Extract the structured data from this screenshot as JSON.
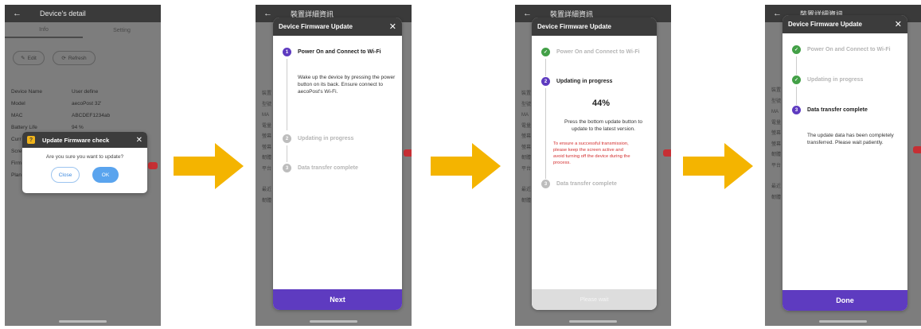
{
  "screen1": {
    "appbar_title": "Device's detail",
    "tabs": [
      "Info",
      "Setting"
    ],
    "edit_label": "Edit",
    "refresh_label": "Refresh",
    "info_rows": [
      {
        "key": "Device Name",
        "value": "User define"
      },
      {
        "key": "Model",
        "value": "aecoPost 32'"
      },
      {
        "key": "MAC",
        "value": "ABCDEF1234ab"
      },
      {
        "key": "Battery Life",
        "value": "94 %"
      },
      {
        "key": "Curr",
        "value": ""
      },
      {
        "key": "Scre",
        "value": ""
      },
      {
        "key": "Firm",
        "value": ""
      },
      {
        "key": "Plan",
        "value": ""
      }
    ],
    "dialog": {
      "title": "Update Firmware check",
      "message": "Are you sure you want to update?",
      "close_label": "Close",
      "ok_label": "OK"
    }
  },
  "bg_appbar_title": "裝置詳細資訊",
  "bg_rows": [
    "裝置",
    "型號",
    "MA",
    "電量",
    "螢幕",
    "螢幕",
    "韌體",
    "平台",
    "",
    "最近",
    "韌體"
  ],
  "screen2": {
    "title": "Device Firmware Update",
    "steps": [
      "Power On and Connect to Wi-Fi",
      "Updating in progress",
      "Data transfer complete"
    ],
    "description": "Wake up the device by pressing the power button on its back. Ensure connect to aecoPost's Wi-Fi.",
    "button": "Next"
  },
  "screen3": {
    "title": "Device Firmware Update",
    "steps": [
      "Power On and Connect to Wi-Fi",
      "Updating in progress",
      "Data transfer complete"
    ],
    "progress_text": "44%",
    "progress": 0.44,
    "description": "Press the bottom update button to update to the latest version.",
    "warning": "To ensure a successful transmission, please keep the screen active and avoid turning off the device during the process.",
    "button": "Please wait"
  },
  "screen4": {
    "title": "Device Firmware Update",
    "steps": [
      "Power On and Connect to Wi-Fi",
      "Updating in progress",
      "Data transfer complete"
    ],
    "description": "The update data has been completely transferred. Please wait patiently.",
    "button": "Done"
  },
  "step_numbers": [
    "1",
    "2",
    "3"
  ],
  "check_glyph": "✓",
  "colors": {
    "accent": "#5e3bc0",
    "success": "#43a047",
    "arrow": "#f4b400",
    "header": "#3c3c3c",
    "warning_text": "#d32f2f"
  }
}
